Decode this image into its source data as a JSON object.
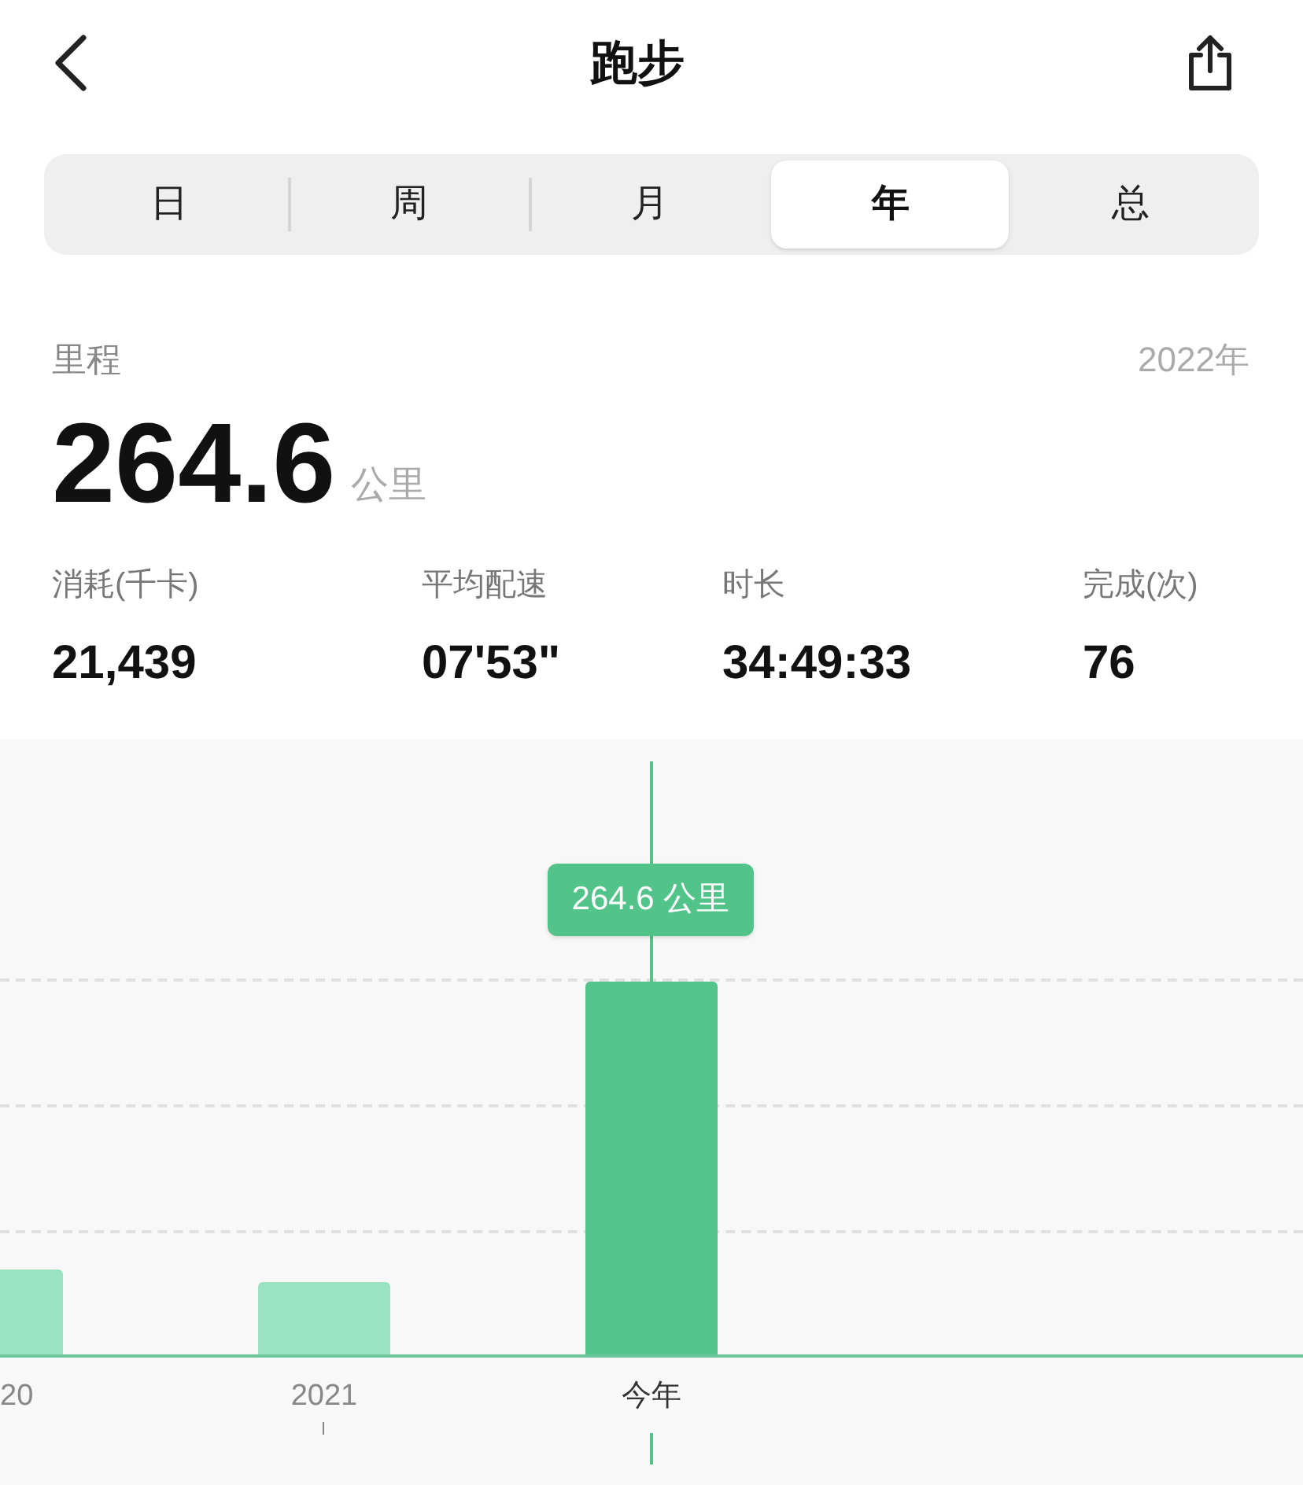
{
  "header": {
    "title": "跑步"
  },
  "tabs": [
    {
      "label": "日",
      "selected": false
    },
    {
      "label": "周",
      "selected": false
    },
    {
      "label": "月",
      "selected": false
    },
    {
      "label": "年",
      "selected": true
    },
    {
      "label": "总",
      "selected": false
    }
  ],
  "summary": {
    "label": "里程",
    "period": "2022年",
    "value": "264.6",
    "unit": "公里"
  },
  "stats": [
    {
      "label": "消耗(千卡)",
      "value": "21,439"
    },
    {
      "label": "平均配速",
      "value": "07'53\""
    },
    {
      "label": "时长",
      "value": "34:49:33"
    },
    {
      "label": "完成(次)",
      "value": "76"
    }
  ],
  "chart": {
    "tooltip": "264.6 公里",
    "bars": [
      {
        "label": "20",
        "selected": false
      },
      {
        "label": "2021",
        "selected": false
      },
      {
        "label": "今年",
        "selected": true
      }
    ]
  }
}
